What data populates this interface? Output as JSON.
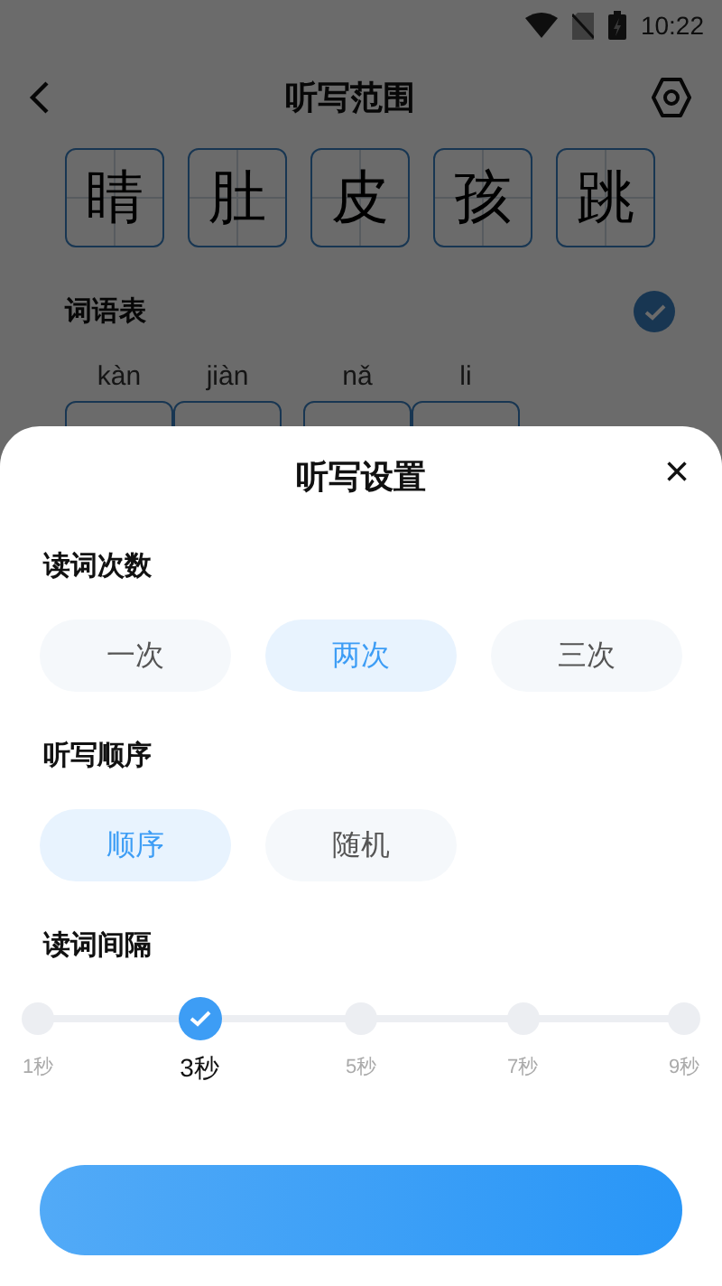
{
  "status_bar": {
    "time": "10:22"
  },
  "header": {
    "title": "听写范围"
  },
  "characters": [
    "睛",
    "肚",
    "皮",
    "孩",
    "跳"
  ],
  "word_list": {
    "label": "词语表",
    "checked": true,
    "words": [
      {
        "syllables": [
          "kàn",
          "jiàn"
        ]
      },
      {
        "syllables": [
          "nǎ",
          "li"
        ]
      }
    ]
  },
  "sheet": {
    "title": "听写设置",
    "close": "×",
    "sections": [
      {
        "kind": "pills",
        "label": "读词次数",
        "options": [
          {
            "label": "一次",
            "selected": false
          },
          {
            "label": "两次",
            "selected": true
          },
          {
            "label": "三次",
            "selected": false
          }
        ]
      },
      {
        "kind": "pills",
        "label": "听写顺序",
        "options": [
          {
            "label": "顺序",
            "selected": true
          },
          {
            "label": "随机",
            "selected": false
          }
        ]
      },
      {
        "kind": "steps",
        "label": "读词间隔",
        "options": [
          {
            "label": "1秒",
            "selected": false
          },
          {
            "label": "3秒",
            "selected": true
          },
          {
            "label": "5秒",
            "selected": false
          },
          {
            "label": "7秒",
            "selected": false
          },
          {
            "label": "9秒",
            "selected": false
          }
        ]
      }
    ]
  }
}
